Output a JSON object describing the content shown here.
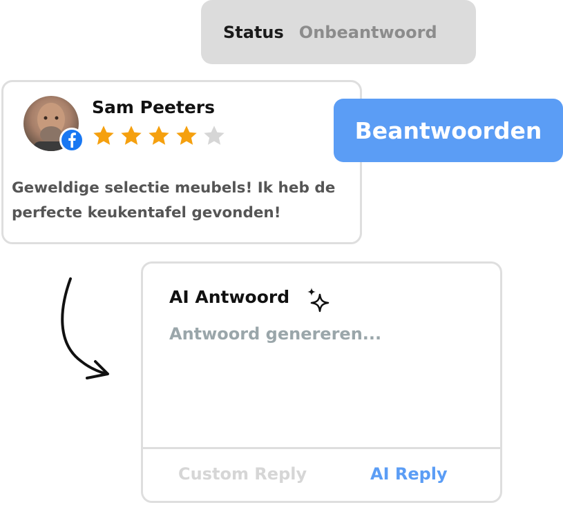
{
  "status": {
    "label": "Status",
    "value": "Onbeantwoord"
  },
  "review": {
    "reviewer_name": "Sam Peeters",
    "source_icon": "facebook-icon",
    "rating": 4,
    "max_rating": 5,
    "text": "Geweldige selectie meubels! Ik heb de perfecte keukentafel gevonden!"
  },
  "reply_button": {
    "label": "Beantwoorden"
  },
  "ai_panel": {
    "title": "AI Antwoord",
    "title_icon": "sparkle-icon",
    "placeholder": "Antwoord genereren...",
    "tabs": [
      {
        "label": "Custom Reply",
        "active": false
      },
      {
        "label": "AI Reply",
        "active": true
      }
    ]
  },
  "colors": {
    "accent": "#5b9df5",
    "star_filled": "#f5a00f",
    "star_empty": "#d6d6d6",
    "facebook": "#1877f2"
  }
}
